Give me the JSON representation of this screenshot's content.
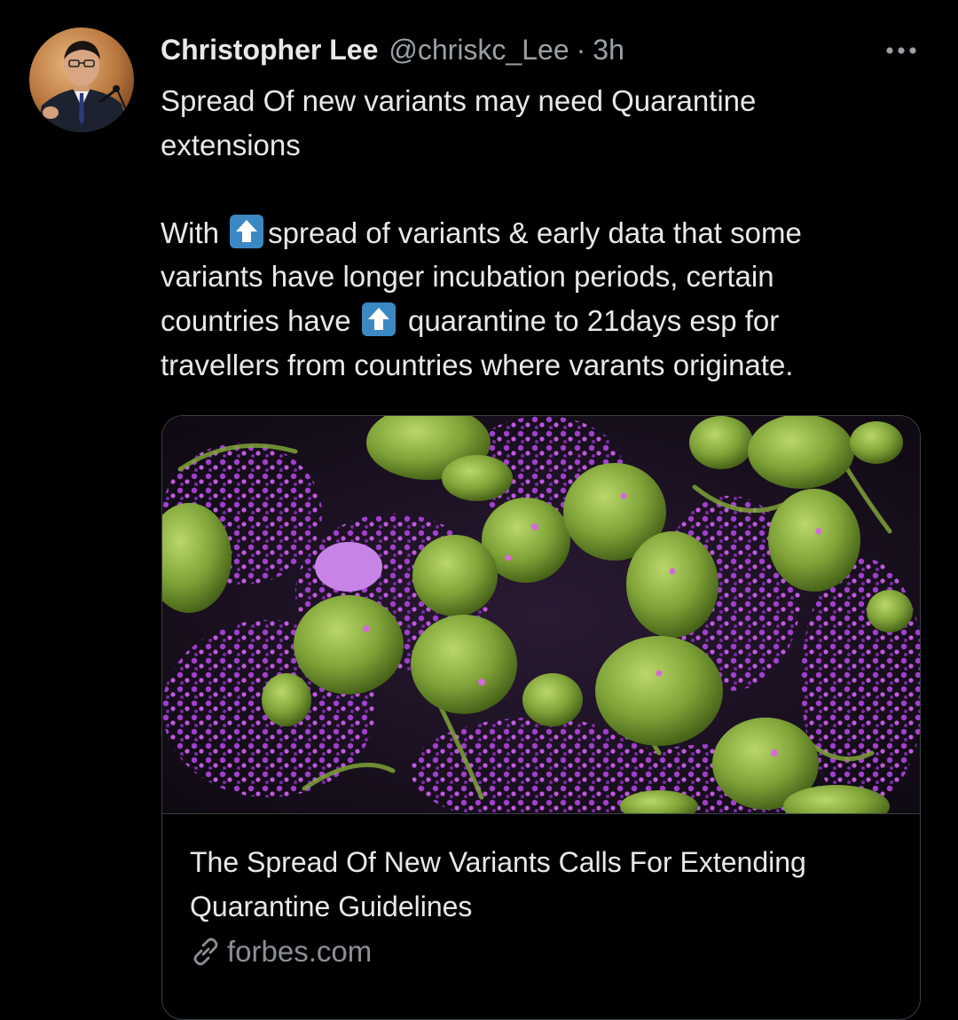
{
  "tweet": {
    "author_name": "Christopher Lee",
    "handle": "@chriskc_Lee",
    "separator": "·",
    "time": "3h",
    "text_line1": "Spread Of new variants may need Quarantine",
    "text_line2": "extensions",
    "text_p2_a": "With ",
    "text_p2_b": "spread of variants & early data that some",
    "text_p2_c": "variants have longer incubation periods, certain",
    "text_p2_d": "countries have ",
    "text_p2_e": " quarantine to 21days esp for",
    "text_p2_f": "travellers from countries where varants originate."
  },
  "card": {
    "title_line1": "The Spread Of New Variants Calls For Extending",
    "title_line2": "Quarantine Guidelines",
    "domain": "forbes.com"
  },
  "icons": {
    "more": "more-icon",
    "up_arrow": "up-arrow-emoji-icon",
    "link": "link-icon"
  },
  "colors": {
    "background": "#000000",
    "primary_text": "#e7e9ea",
    "secondary_text": "#9aa0a6",
    "border": "#3b3f44",
    "emoji_blue": "#3b88c3"
  }
}
